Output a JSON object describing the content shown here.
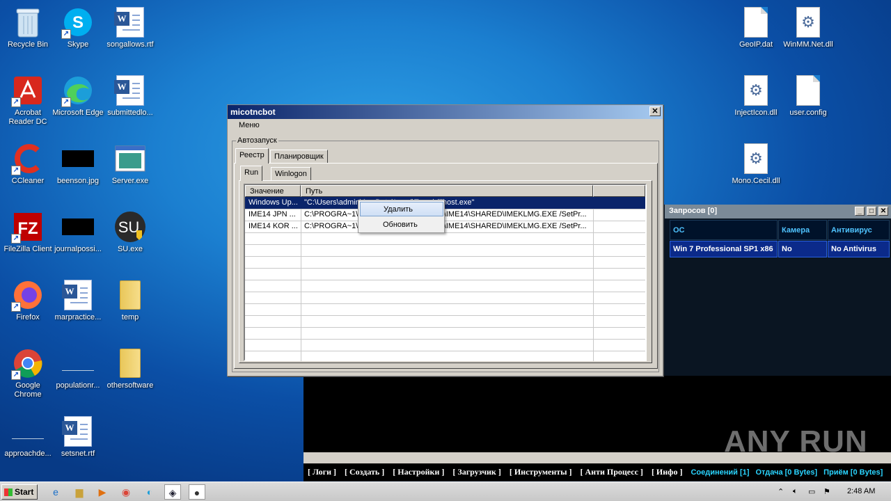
{
  "desktop": {
    "icons": [
      {
        "label": "Recycle Bin",
        "kind": "recycle-bin-icon"
      },
      {
        "label": "Skype",
        "kind": "skype-icon"
      },
      {
        "label": "songallows.rtf",
        "kind": "word-document-icon"
      },
      {
        "label": "Acrobat Reader DC",
        "kind": "acrobat-icon"
      },
      {
        "label": "Microsoft Edge",
        "kind": "edge-icon"
      },
      {
        "label": "submittedlo...",
        "kind": "word-document-icon"
      },
      {
        "label": "CCleaner",
        "kind": "ccleaner-icon"
      },
      {
        "label": "beenson.jpg",
        "kind": "image-file-icon"
      },
      {
        "label": "Server.exe",
        "kind": "exe-icon"
      },
      {
        "label": "FileZilla Client",
        "kind": "filezilla-icon"
      },
      {
        "label": "journalpossi...",
        "kind": "image-file-icon"
      },
      {
        "label": "SU.exe",
        "kind": "su-exe-icon"
      },
      {
        "label": "Firefox",
        "kind": "firefox-icon"
      },
      {
        "label": "marpractice...",
        "kind": "word-document-icon"
      },
      {
        "label": "temp",
        "kind": "folder-icon"
      },
      {
        "label": "Google Chrome",
        "kind": "chrome-icon"
      },
      {
        "label": "populationr...",
        "kind": "file-icon"
      },
      {
        "label": "othersoftware",
        "kind": "folder-icon"
      },
      {
        "label": "approachde...",
        "kind": "file-icon"
      },
      {
        "label": "setsnet.rtf",
        "kind": "word-document-icon"
      },
      {
        "label": "GeoIP.dat",
        "kind": "blank-file-icon"
      },
      {
        "label": "WinMM.Net.dll",
        "kind": "dll-icon"
      },
      {
        "label": "InjectIcon.dll",
        "kind": "dll-icon"
      },
      {
        "label": "user.config",
        "kind": "blank-file-icon"
      },
      {
        "label": "Mono.Cecil.dll",
        "kind": "dll-icon"
      }
    ]
  },
  "window": {
    "title": "micotncbot",
    "close": "✕",
    "menu": "Меню",
    "group": "Автозапуск",
    "tabs": [
      "Реестр",
      "Планировщик"
    ],
    "subtabs": [
      "Run",
      "Winlogon"
    ],
    "columns": [
      "Значение",
      "Путь"
    ],
    "rows": [
      {
        "name": "Windows Up...",
        "path": "\"C:\\Users\\admin\\AppData\\Local\\Temp\\dllhost.exe\""
      },
      {
        "name": "IME14 JPN ...",
        "path": "C:\\PROGRA~1\\COMMON~1\\MICROS~1\\IME14\\SHARED\\IMEKLMG.EXE /SetPr..."
      },
      {
        "name": "IME14 KOR ...",
        "path": "C:\\PROGRA~1\\COMMON~1\\MICROS~1\\IME14\\SHARED\\IMEKLMG.EXE /SetPr..."
      }
    ],
    "context_menu": [
      "Удалить",
      "Обновить"
    ]
  },
  "bot_panel": {
    "title": "Запросов [0]",
    "buttons": [
      "_",
      "□",
      "✕"
    ],
    "headers": [
      "ОС",
      "Камера",
      "Антивирус"
    ],
    "row": {
      "os": "Win 7 Professional SP1 x86",
      "camera": "No",
      "antivirus": "No Antivirus"
    },
    "status": [
      "[ Логи ]",
      "[ Создать ]",
      "[ Настройки ]",
      "[ Загрузчик ]",
      "[ Инструменты ]",
      "[ Анти Процесс ]",
      "[ Инфо ]"
    ],
    "counters": [
      "Соединений [1]",
      "Отдача [0 Bytes]",
      "Приём [0 Bytes]"
    ]
  },
  "watermark": "ANY RUN",
  "taskbar": {
    "start": "Start",
    "time": "2:48 AM"
  }
}
